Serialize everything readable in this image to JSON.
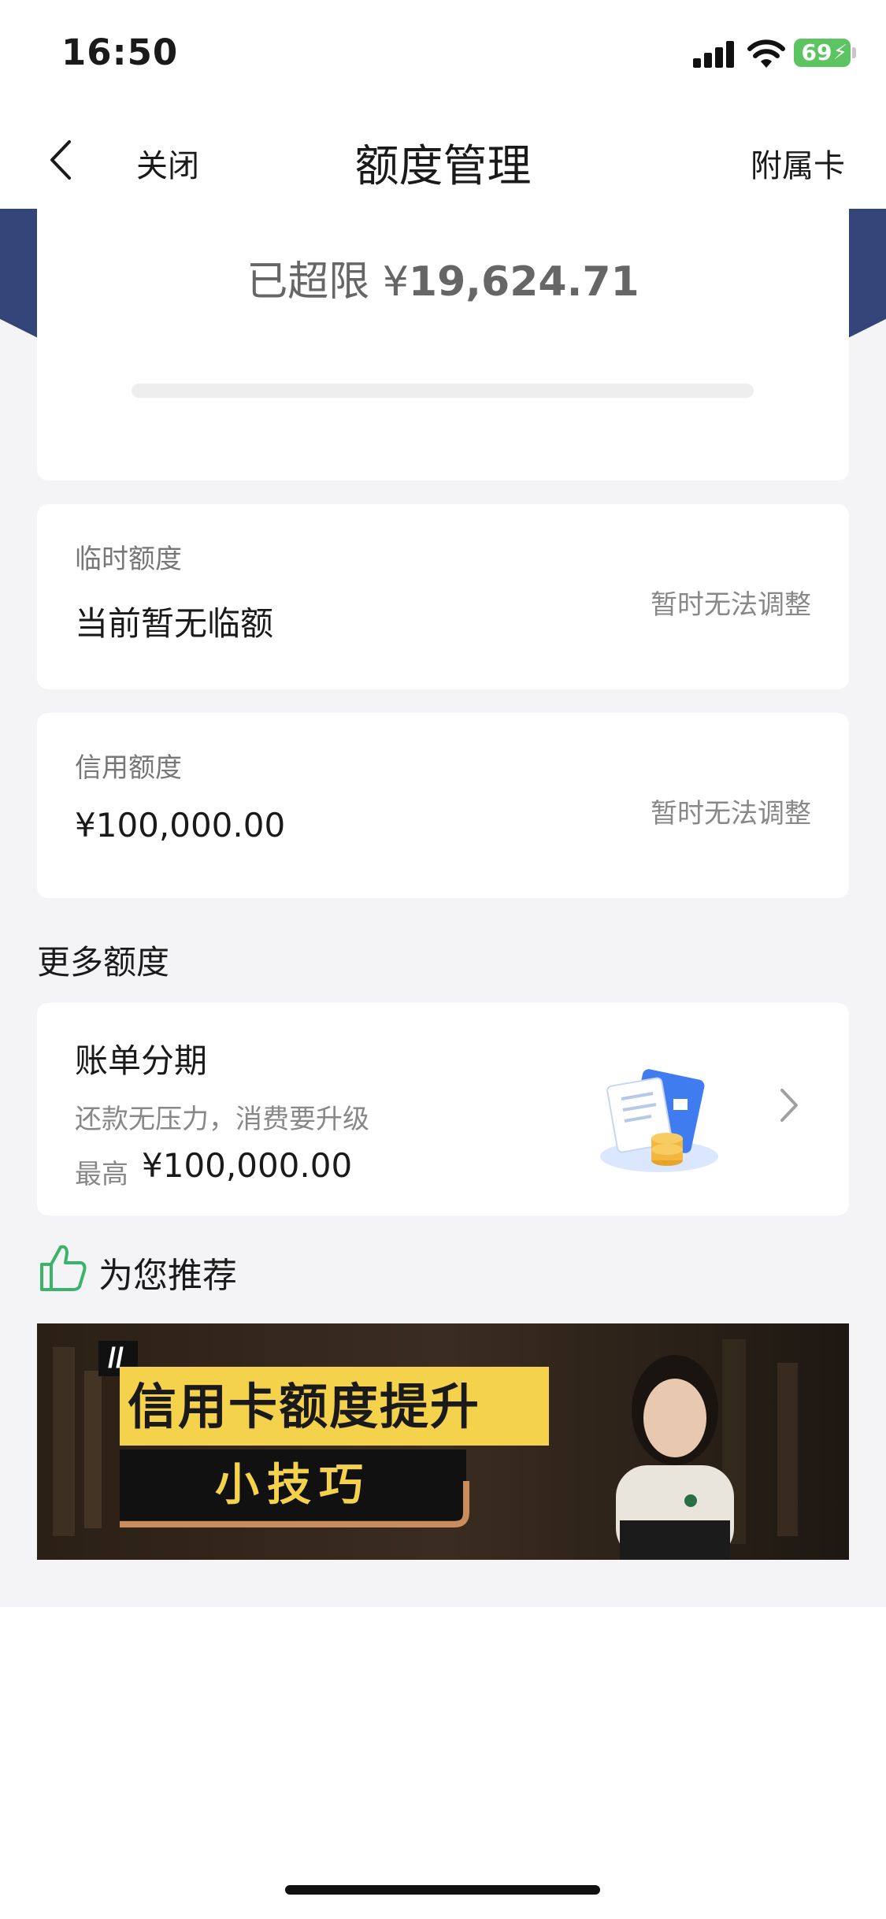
{
  "status_bar": {
    "time": "16:50",
    "battery_level": "69",
    "battery_color": "#5cc561"
  },
  "nav": {
    "close_label": "关闭",
    "title": "额度管理",
    "right_label": "附属卡",
    "back_icon": "chevron-left-icon"
  },
  "limit": {
    "status_label": "已超限",
    "currency": "¥",
    "amount": "19,624.71",
    "usage_progress": 0
  },
  "temporary_limit": {
    "label": "临时额度",
    "value": "当前暂无临额",
    "action": "暂时无法调整"
  },
  "credit_limit": {
    "label": "信用额度",
    "value": "¥100,000.00",
    "action": "暂时无法调整"
  },
  "more_limits": {
    "section_title": "更多额度",
    "installment": {
      "title": "账单分期",
      "subtitle": "还款无压力，消费要升级",
      "max_label": "最高",
      "max_amount": "¥100,000.00",
      "icon": "bill-coins-icon"
    }
  },
  "recommend": {
    "title": "为您推荐",
    "icon": "thumbs-up-icon",
    "banner": {
      "headline": "信用卡额度提升",
      "subline": "小技巧"
    }
  },
  "colors": {
    "accent_blue": "#34457a",
    "page_bg": "#f4f4f6",
    "banner_yellow": "#f5d24b"
  }
}
